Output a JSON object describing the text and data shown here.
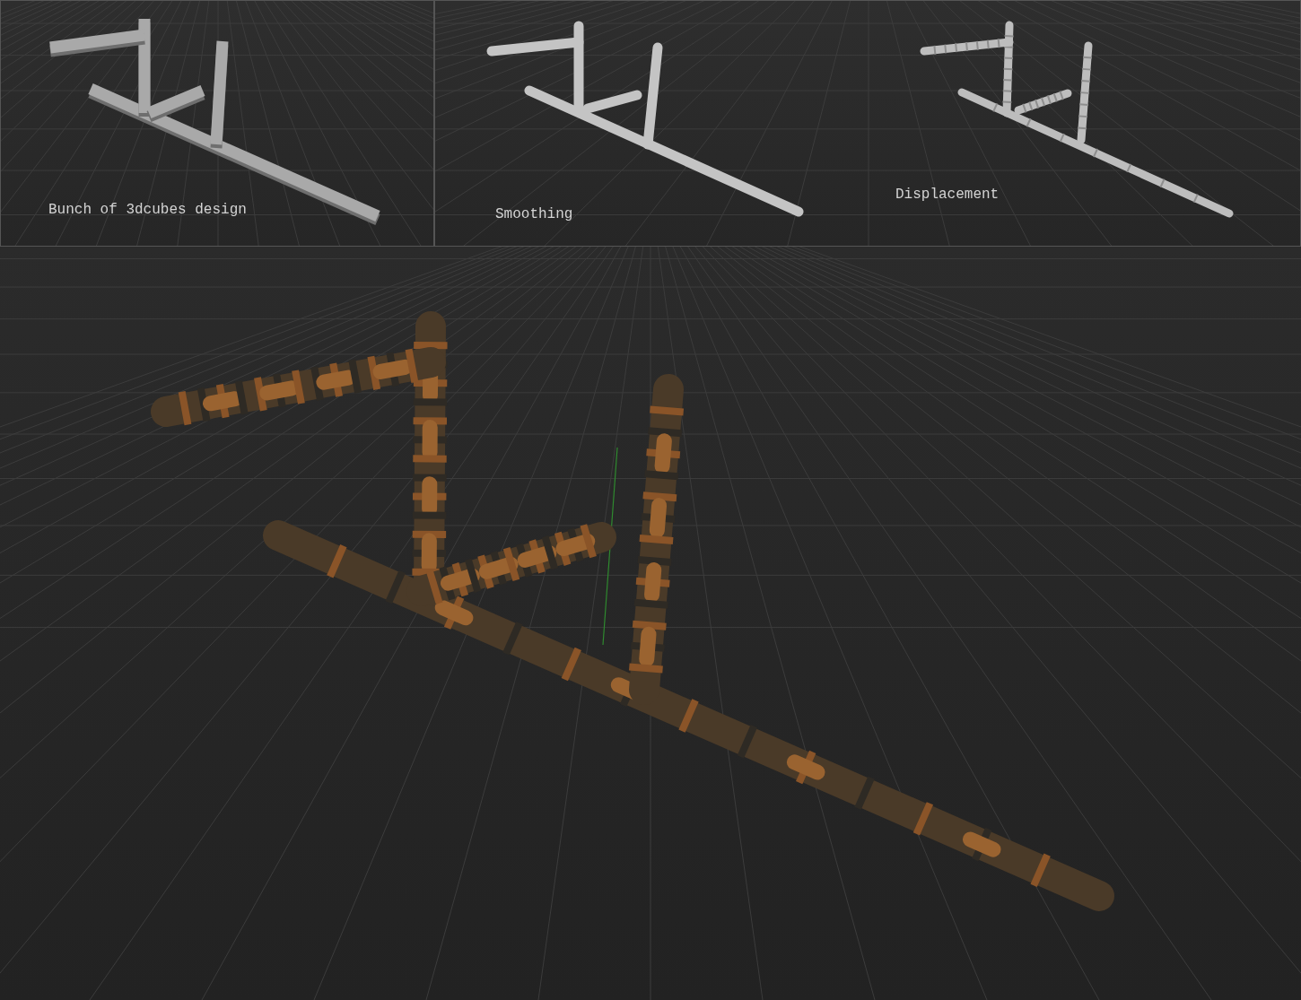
{
  "top_viewports": [
    {
      "stages": [
        {
          "kind": "cubes",
          "caption": "Bunch of 3dcubes design"
        }
      ]
    },
    {
      "stages": [
        {
          "kind": "smooth",
          "caption": "Smoothing"
        },
        {
          "kind": "displace",
          "caption": "Displacement"
        }
      ]
    }
  ],
  "main_viewport": {
    "stages": [
      {
        "kind": "textured"
      }
    ]
  }
}
